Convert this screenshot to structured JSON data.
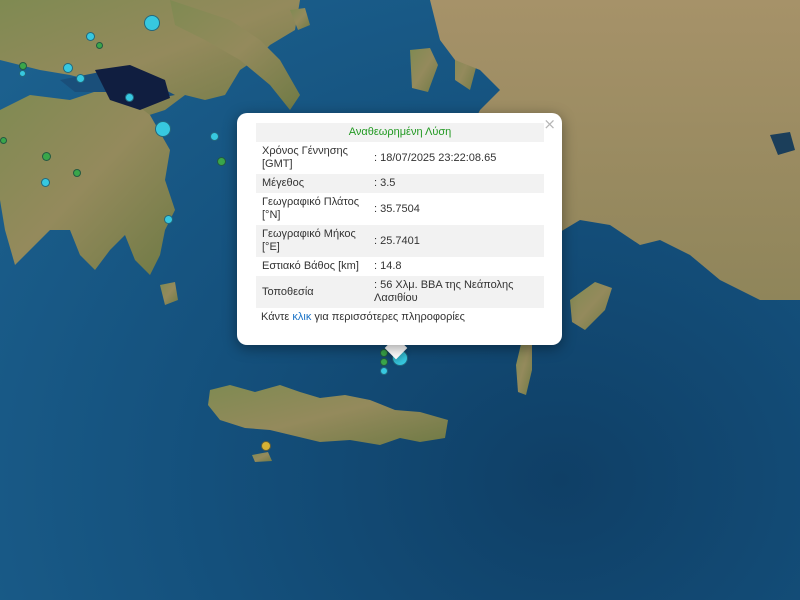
{
  "popup": {
    "title": "Αναθεωρημένη Λύση",
    "close_symbol": "×",
    "rows": [
      {
        "label": "Χρόνος Γέννησης [GMT]",
        "value": ": 18/07/2025 23:22:08.65"
      },
      {
        "label": "Μέγεθος",
        "value": ": 3.5"
      },
      {
        "label": "Γεωγραφικό Πλάτος [°N]",
        "value": ": 35.7504"
      },
      {
        "label": "Γεωγραφικό Μήκος [°E]",
        "value": ": 25.7401"
      },
      {
        "label": "Εστιακό Βάθος [km]",
        "value": ": 14.8"
      },
      {
        "label": "Τοποθεσία",
        "value": ": 56 Χλμ. ΒΒΑ της Νεάπολης Λασιθίου"
      }
    ],
    "more_prefix": "Κάντε ",
    "more_link": "κλικ",
    "more_suffix": " για περισσότερες πληροφορίες"
  },
  "marker_colors": {
    "cyan": "#37c8e0",
    "green": "#3aa64a",
    "yellow": "#d7b234"
  }
}
